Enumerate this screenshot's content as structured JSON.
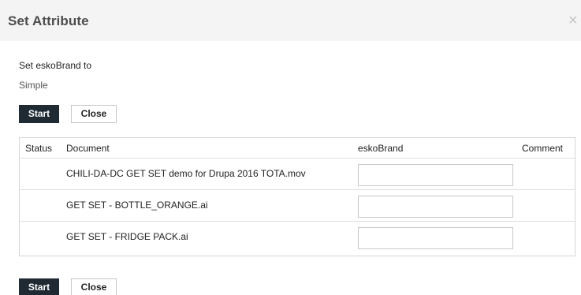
{
  "dialog": {
    "title": "Set Attribute",
    "close_glyph": "×"
  },
  "form": {
    "set_label": "Set eskoBrand to",
    "value": "Simple"
  },
  "buttons": {
    "start_label": "Start",
    "close_label": "Close"
  },
  "table": {
    "columns": [
      "Status",
      "Document",
      "eskoBrand",
      "Comment"
    ],
    "rows": [
      {
        "status": "",
        "document": "CHILI-DA-DC GET SET demo for Drupa 2016 TOTA.mov",
        "eskoBrand": "",
        "comment": ""
      },
      {
        "status": "",
        "document": "GET SET - BOTTLE_ORANGE.ai",
        "eskoBrand": "",
        "comment": ""
      },
      {
        "status": "",
        "document": "GET SET - FRIDGE PACK.ai",
        "eskoBrand": "",
        "comment": ""
      }
    ]
  },
  "colors": {
    "header_bg": "#f4f4f4",
    "start_button_bg": "#1f2a33",
    "border": "#d6d6d6"
  }
}
